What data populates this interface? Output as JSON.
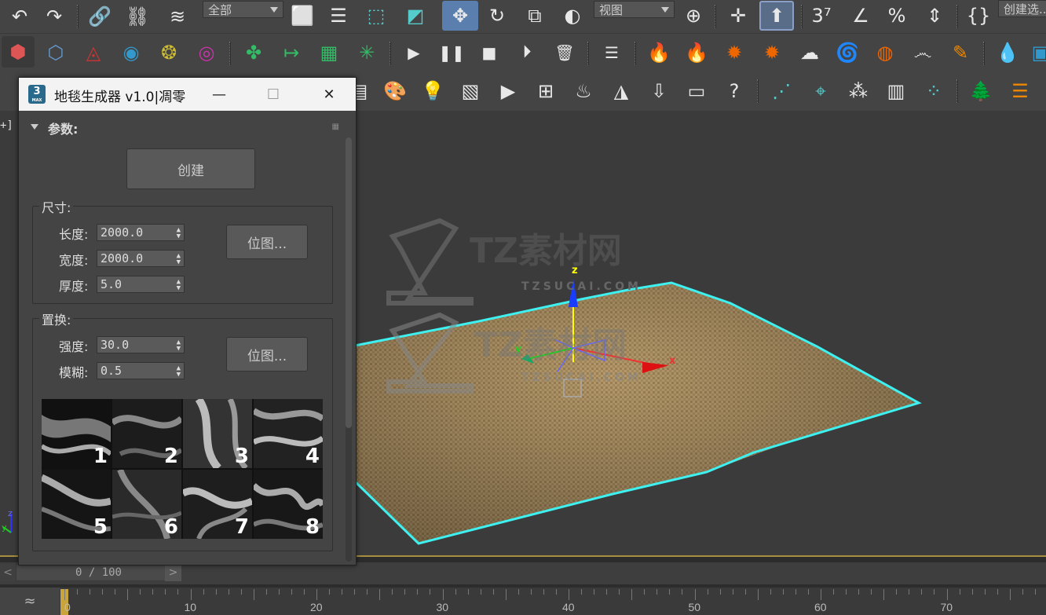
{
  "toolbar1": {
    "selection_filter": "全部",
    "ref_coord": "视图",
    "named_sel": "创建选..."
  },
  "viewport": {
    "label": "+]",
    "watermark_text": "TZ素材网",
    "watermark_sub": "TZSUCAI.COM",
    "gizmo_axes": {
      "x": "x",
      "y": "y",
      "z": "z"
    },
    "axis_z": "z",
    "axis_y": "y",
    "axis_x": "x"
  },
  "dialog": {
    "title": "地毯生成器 v1.0|凋零",
    "minimize": "—",
    "maximize": "☐",
    "close": "✕",
    "rollup_label": "参数:",
    "create_label": "创建",
    "size_group": {
      "label": "尺寸:",
      "length_label": "长度:",
      "length_value": "2000.0",
      "width_label": "宽度:",
      "width_value": "2000.0",
      "thickness_label": "厚度:",
      "thickness_value": "5.0",
      "bitmap_label": "位图..."
    },
    "disp_group": {
      "label": "置换:",
      "strength_label": "强度:",
      "strength_value": "30.0",
      "blur_label": "模糊:",
      "blur_value": "0.5",
      "bitmap_label": "位图..."
    },
    "thumbnails": [
      "1",
      "2",
      "3",
      "4",
      "5",
      "6",
      "7",
      "8"
    ]
  },
  "timeline": {
    "slider_text": "0 / 100",
    "prev": "<",
    "next": ">",
    "ticks": [
      "0",
      "10",
      "20",
      "30",
      "40",
      "50",
      "60",
      "70"
    ]
  }
}
